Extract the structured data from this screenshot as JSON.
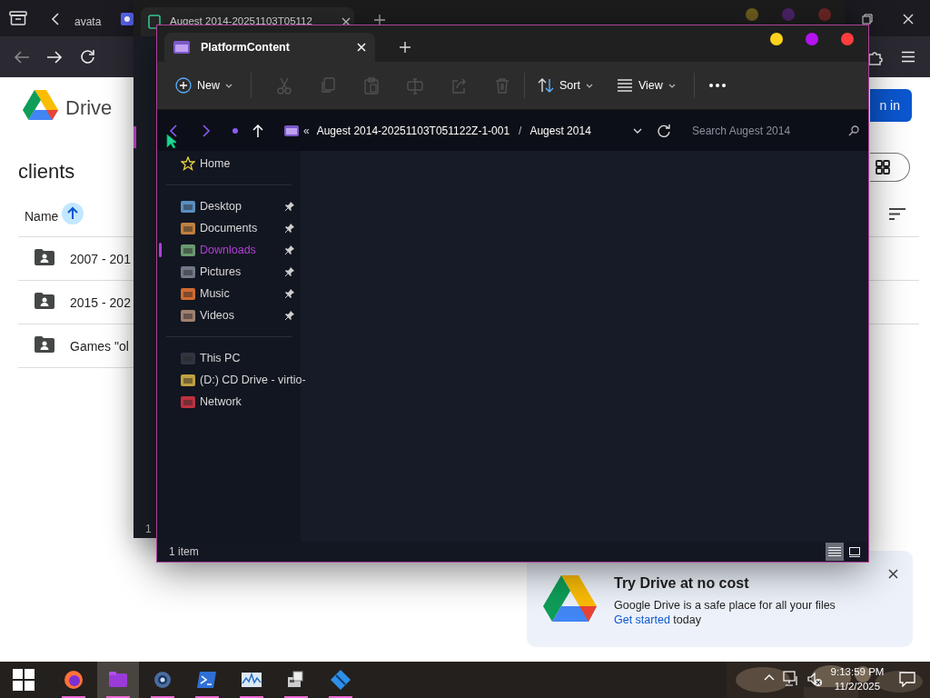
{
  "browser": {
    "tab_text": "avata",
    "drive_title": "Drive",
    "folder_title": "clients",
    "sort_column": "Name",
    "sign_in_partial": "n in",
    "files": [
      {
        "name": "2007 - 201"
      },
      {
        "name": "2015 - 202"
      },
      {
        "name": "Games \"ol"
      }
    ]
  },
  "back_window": {
    "tab_title": "Augest 2014-20251103T05112",
    "status": "1"
  },
  "explorer": {
    "tab_title": "PlatformContent",
    "toolbar": [
      {
        "kind": "new",
        "label": "New"
      },
      {
        "kind": "cut",
        "disabled": true
      },
      {
        "kind": "copy",
        "disabled": true
      },
      {
        "kind": "paste",
        "disabled": true
      },
      {
        "kind": "rename",
        "disabled": true
      },
      {
        "kind": "share",
        "disabled": true
      },
      {
        "kind": "delete",
        "disabled": true
      },
      {
        "kind": "sort",
        "label": "Sort"
      },
      {
        "kind": "view",
        "label": "View"
      },
      {
        "kind": "more"
      }
    ],
    "address": {
      "overflow": "«",
      "crumbs": [
        "Augest 2014-20251103T051122Z-1-001",
        "Augest 2014"
      ],
      "separator": "/"
    },
    "search": {
      "placeholder": "Search Augest 2014"
    },
    "sidebar": [
      [
        {
          "label": "Home",
          "pinned": false,
          "selected": false
        }
      ],
      [
        {
          "label": "Desktop",
          "pinned": true,
          "selected": false
        },
        {
          "label": "Documents",
          "pinned": true,
          "selected": false
        },
        {
          "label": "Downloads",
          "pinned": true,
          "selected": true
        },
        {
          "label": "Pictures",
          "pinned": true,
          "selected": false
        },
        {
          "label": "Music",
          "pinned": true,
          "selected": false
        },
        {
          "label": "Videos",
          "pinned": true,
          "selected": false
        }
      ],
      [
        {
          "label": "This PC",
          "pinned": false,
          "selected": false
        },
        {
          "label": "(D:) CD Drive - virtio-",
          "pinned": false,
          "selected": false
        },
        {
          "label": "Network",
          "pinned": false,
          "selected": false
        }
      ]
    ],
    "status": "1 item",
    "views": [
      {
        "kind": "details",
        "selected": true
      },
      {
        "kind": "tiles",
        "selected": false
      }
    ]
  },
  "promo": {
    "title": "Try Drive at no cost",
    "text": "Google Drive is a safe place for all your files",
    "link": "Get started",
    "after": "today"
  },
  "taskbar": {
    "apps": [
      {
        "kind": "browser",
        "active": false
      },
      {
        "kind": "files",
        "active": true
      },
      {
        "kind": "settings",
        "active": false
      },
      {
        "kind": "terminal",
        "active": false
      },
      {
        "kind": "monitor",
        "active": false
      },
      {
        "kind": "tool",
        "active": false
      },
      {
        "kind": "app",
        "active": false
      }
    ],
    "time": "9:13:59 PM",
    "date": "11/2/2025"
  }
}
